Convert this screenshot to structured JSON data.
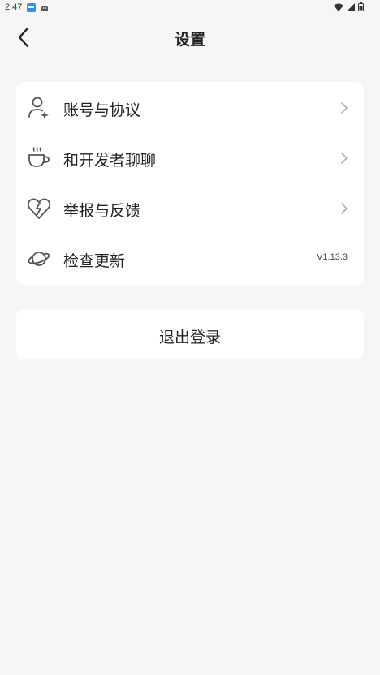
{
  "status_bar": {
    "time": "2:47"
  },
  "header": {
    "title": "设置"
  },
  "menu": [
    {
      "label": "账号与协议",
      "icon": "user-sparkle-icon"
    },
    {
      "label": "和开发者聊聊",
      "icon": "coffee-cup-icon"
    },
    {
      "label": "举报与反馈",
      "icon": "broken-heart-icon"
    },
    {
      "label": "检查更新",
      "icon": "planet-icon",
      "value": "V1.13.3"
    }
  ],
  "logout": {
    "label": "退出登录"
  }
}
